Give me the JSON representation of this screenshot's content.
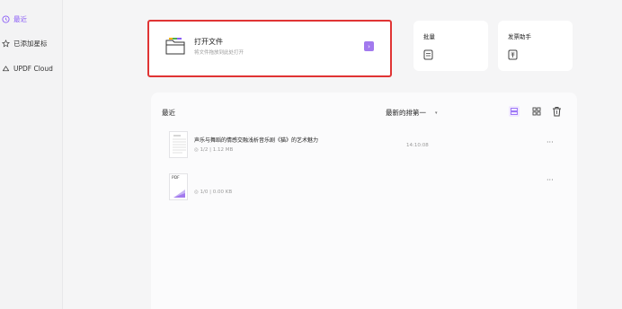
{
  "sidebar": {
    "items": [
      {
        "label": "最近",
        "icon": "clock-icon",
        "active": true
      },
      {
        "label": "已添加星标",
        "icon": "star-icon",
        "active": false
      },
      {
        "label": "UPDF Cloud",
        "icon": "cloud-icon",
        "active": false
      }
    ]
  },
  "open_file": {
    "title": "打开文件",
    "subtitle": "将文件拖放到此处打开",
    "arrow": "›"
  },
  "quick_actions": [
    {
      "label": "批量",
      "icon": "batch-icon"
    },
    {
      "label": "发票助手",
      "icon": "invoice-icon"
    }
  ],
  "recent": {
    "title": "最近",
    "sort_label": "最新的排第一",
    "sort_caret": "▾",
    "files": [
      {
        "name": "声乐与舞蹈的情感交融浅析音乐剧《猫》的艺术魅力",
        "pages": "1/2",
        "size": "1.12 MB",
        "time": "14:10:08",
        "thumb_label": "",
        "more": "···"
      },
      {
        "name": "",
        "pages": "1/0",
        "size": "0.00 KB",
        "time": "",
        "thumb_label": "PDF",
        "more": "···"
      }
    ]
  },
  "colors": {
    "accent": "#8a5cf6",
    "highlight": "#e03434"
  }
}
